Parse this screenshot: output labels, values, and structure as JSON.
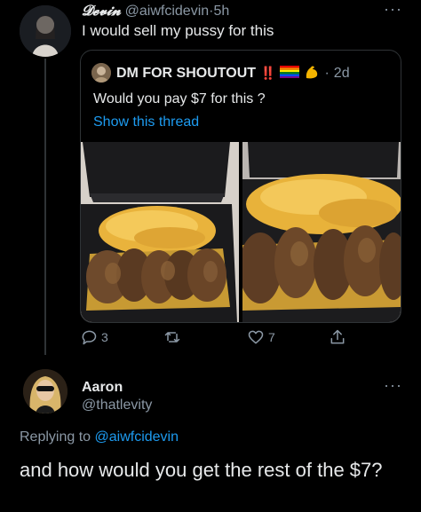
{
  "tweet": {
    "author_name": "𝓓𝓮𝓿𝓲𝓷",
    "handle": "@aiwfcidevin",
    "separator": "·",
    "time": "5h",
    "text": "I would sell my pussy for this",
    "more": "···"
  },
  "quote": {
    "author_name": "DM FOR SHOUTOUT",
    "emoji": [
      "‼️",
      "🏳️‍🌈",
      "💪"
    ],
    "separator": "·",
    "time": "2d",
    "text": "Would you pay $7 for this ?",
    "show_thread": "Show this thread"
  },
  "actions": {
    "replies": "3",
    "retweets": "",
    "likes": "7"
  },
  "reply": {
    "author_name": "Aaron",
    "handle": "@thatlevity",
    "more": "···",
    "replying_prefix": "Replying to ",
    "replying_to": "@aiwfcidevin",
    "text": "and how would you get the rest of the $7?"
  },
  "colors": {
    "background": "#000000",
    "text": "#e7e9ea",
    "muted": "#8b98a5",
    "link": "#1d9bf0",
    "border": "#2f3336"
  }
}
